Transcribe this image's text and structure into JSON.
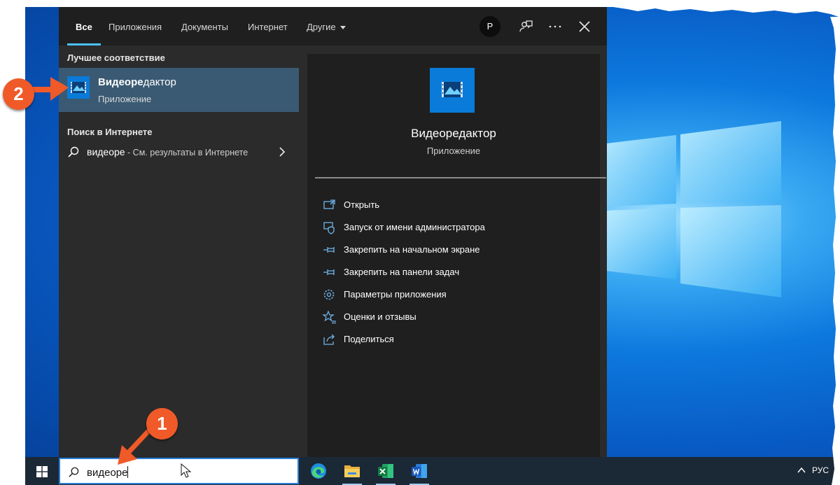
{
  "tabs": [
    {
      "label": "Все"
    },
    {
      "label": "Приложения"
    },
    {
      "label": "Документы"
    },
    {
      "label": "Интернет"
    },
    {
      "label": "Другие"
    }
  ],
  "header": {
    "avatar_letter": "P"
  },
  "left": {
    "best_match_title": "Лучшее соответствие",
    "best_match": {
      "name_bold": "Видеоре",
      "name_rest": "дактор",
      "type": "Приложение"
    },
    "web_title": "Поиск в Интернете",
    "web_result": {
      "query": "видеоре",
      "suffix": " - См. результаты в Интернете"
    }
  },
  "detail": {
    "app_name": "Видеоредактор",
    "app_type": "Приложение",
    "actions": [
      {
        "icon": "open-icon",
        "label": "Открыть"
      },
      {
        "icon": "shield-icon",
        "label": "Запуск от имени администратора"
      },
      {
        "icon": "pin-icon",
        "label": "Закрепить на начальном экране"
      },
      {
        "icon": "pin-icon",
        "label": "Закрепить на панели задач"
      },
      {
        "icon": "gear-icon",
        "label": "Параметры приложения"
      },
      {
        "icon": "star-icon",
        "label": "Оценки и отзывы"
      },
      {
        "icon": "share-icon",
        "label": "Поделиться"
      }
    ]
  },
  "taskbar": {
    "search_value": "видеоре",
    "apps": [
      "edge-icon",
      "file-explorer-icon",
      "excel-icon",
      "word-icon"
    ],
    "language": "РУС"
  },
  "annotations": {
    "step_1": "1",
    "step_2": "2"
  },
  "colors": {
    "accent": "#4cc2ff",
    "selection": "#3a5a73",
    "badge": "#f05a28",
    "app_tile": "#0a7bd8"
  }
}
